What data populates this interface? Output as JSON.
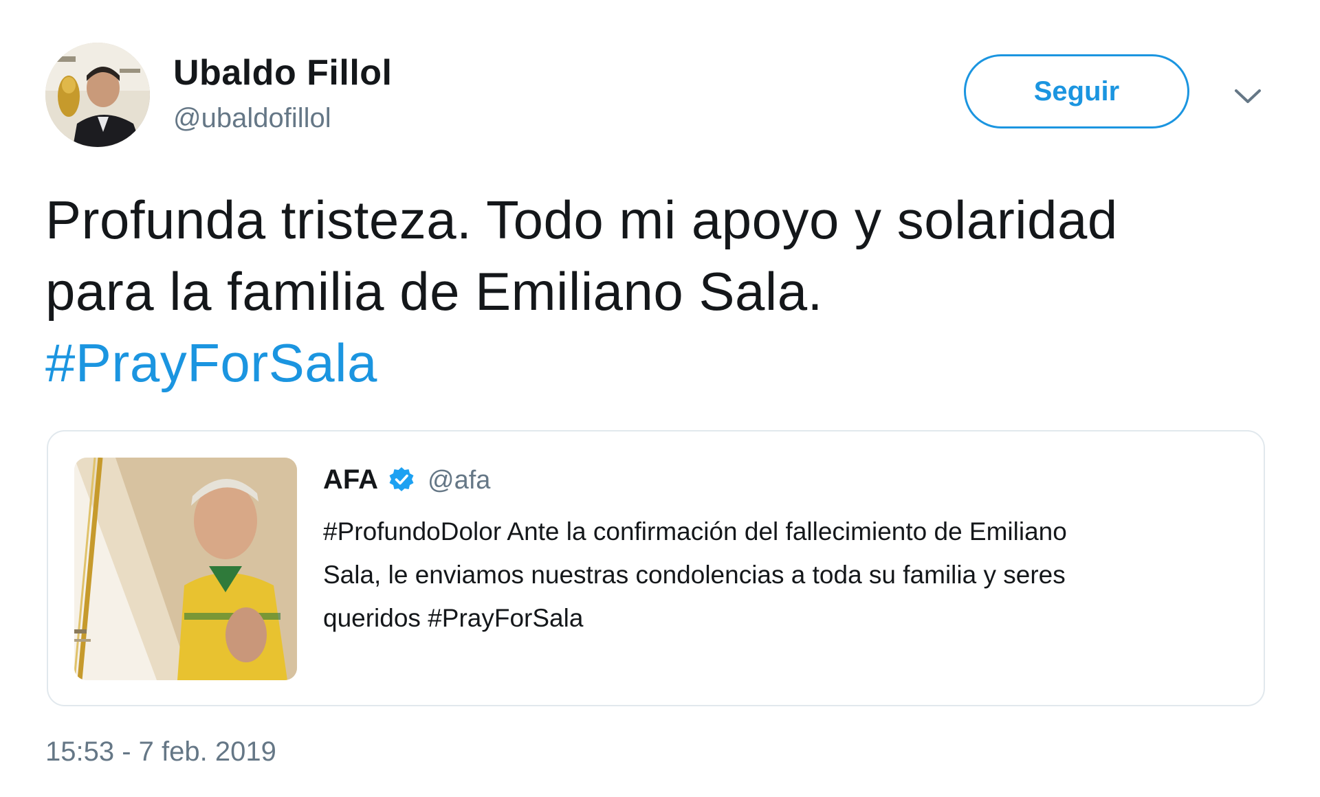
{
  "author": {
    "name": "Ubaldo Fillol",
    "handle": "@ubaldofillol"
  },
  "follow_button": {
    "label": "Seguir"
  },
  "caret_icon": "chevron-down-icon",
  "tweet": {
    "lines": [
      "Profunda tristeza. Todo mi apoyo y solaridad",
      "para la familia de Emiliano Sala."
    ],
    "hashtag": "#PrayForSala"
  },
  "quoted_tweet": {
    "name": "AFA",
    "verified_icon": "verified-badge-icon",
    "handle": "@afa",
    "lines": [
      "#ProfundoDolor Ante la confirmación del fallecimiento de Emiliano",
      "Sala, le enviamos nuestras condolencias a toda su familia y seres",
      "queridos #PrayForSala"
    ]
  },
  "timestamp": "15:53 - 7 feb. 2019",
  "colors": {
    "accent": "#1b95e0",
    "text": "#14171a",
    "secondary": "#657786",
    "border": "#e1e8ed"
  }
}
